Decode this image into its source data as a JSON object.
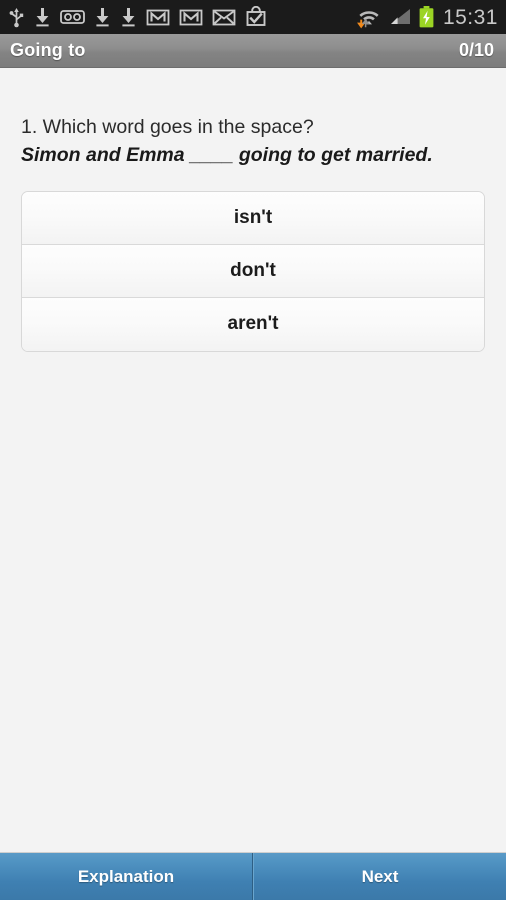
{
  "status_bar": {
    "time": "15:31",
    "icons_left": [
      "usb-icon",
      "download-icon",
      "voicemail-icon",
      "download-icon",
      "download-icon",
      "gmail-icon",
      "gmail-icon",
      "email-icon",
      "play-store-icon"
    ],
    "icons_right": [
      "wifi-transfer-icon",
      "cellular-signal-icon",
      "battery-charging-icon"
    ],
    "background": "#1b1b1b",
    "text_color": "#c9c9c9"
  },
  "title_bar": {
    "title": "Going to",
    "counter": "0/10",
    "background": "#8d8d8d"
  },
  "question": {
    "prompt": "1. Which word goes in the space?",
    "sentence": "Simon and Emma ____ going to get married."
  },
  "options": [
    {
      "label": "isn't"
    },
    {
      "label": "don't"
    },
    {
      "label": "aren't"
    }
  ],
  "buttons": {
    "explanation": "Explanation",
    "next": "Next",
    "accent": "#4585b8"
  }
}
